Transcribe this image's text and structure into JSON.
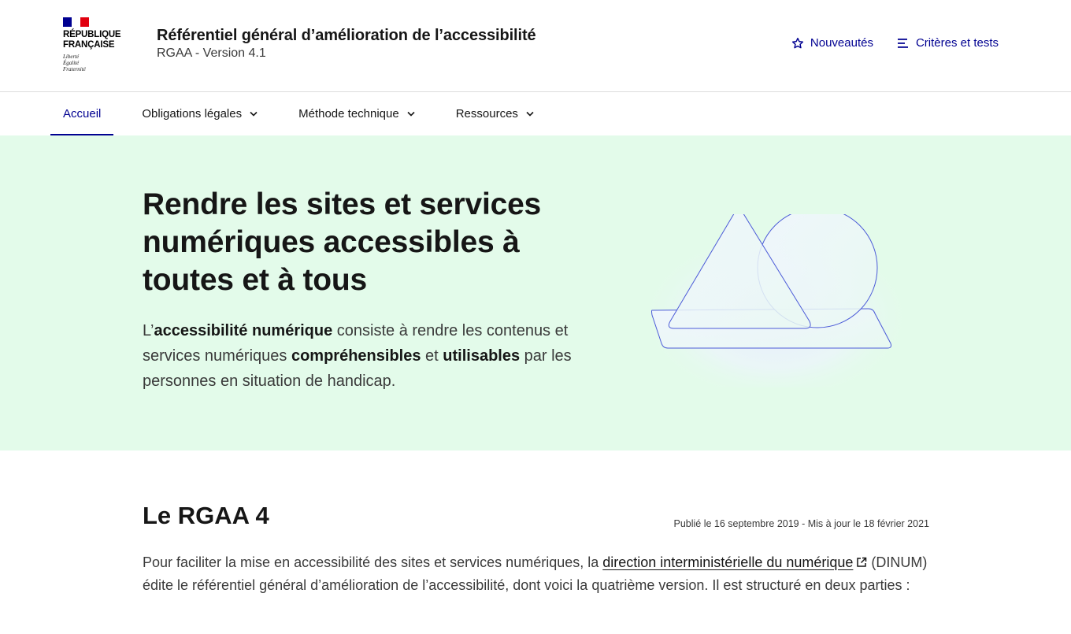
{
  "logo": {
    "title_line1": "RÉPUBLIQUE",
    "title_line2": "FRANÇAISE",
    "motto_line1": "Liberté",
    "motto_line2": "Égalité",
    "motto_line3": "Fraternité",
    "flag_colors": [
      "#000091",
      "#ffffff",
      "#e1000f"
    ]
  },
  "service": {
    "title": "Référentiel général d’amélioration de l’accessibilité",
    "subtitle": "RGAA - Version 4.1"
  },
  "tools": {
    "news_label": "Nouveautés",
    "news_icon": "star-icon",
    "criteria_label": "Critères et tests",
    "criteria_icon": "menu-lines-icon"
  },
  "nav": {
    "items": [
      {
        "label": "Accueil",
        "active": true
      },
      {
        "label": "Obligations légales",
        "dropdown": true
      },
      {
        "label": "Méthode technique",
        "dropdown": true
      },
      {
        "label": "Ressources",
        "dropdown": true
      }
    ]
  },
  "hero": {
    "title": "Rendre les sites et services numériques accessibles à toutes et à tous",
    "text": {
      "p1": "L’",
      "b1": "accessibilité numérique",
      "p2": " consiste à rendre les contenus et services numériques ",
      "b2": "compréhensibles",
      "p3": " et ",
      "b3": "utilisables",
      "p4": " par les personnes en situation de handicap."
    }
  },
  "section": {
    "title": "Le RGAA 4",
    "date": "Publié le 16 septembre 2019 - Mis à jour le 18 février 2021",
    "para_before": "Pour faciliter la mise en accessibilité des sites et services numériques, la ",
    "link": "direction interministérielle du numérique",
    "para_after": " (DINUM) édite le référentiel général d’amélioration de l’accessibilité, dont voici la quatrième version. Il est structuré en deux parties :"
  },
  "colors": {
    "primary": "#000091",
    "hero_bg": "#e3fbea",
    "text": "#161616"
  }
}
